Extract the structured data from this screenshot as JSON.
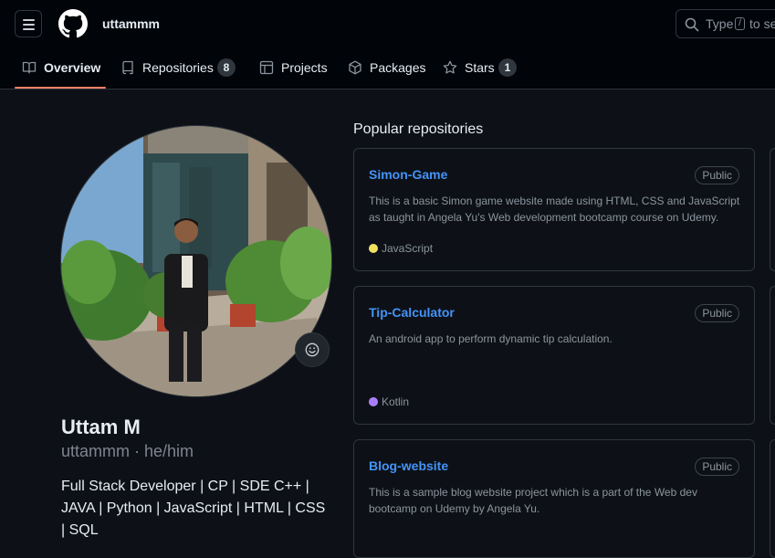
{
  "header": {
    "username": "uttammm",
    "search": {
      "prefix": "Type",
      "key": "/",
      "suffix": "to se"
    }
  },
  "tabs": [
    {
      "label": "Overview",
      "icon": "book-icon"
    },
    {
      "label": "Repositories",
      "icon": "repo-icon",
      "count": "8"
    },
    {
      "label": "Projects",
      "icon": "table-icon"
    },
    {
      "label": "Packages",
      "icon": "package-icon"
    },
    {
      "label": "Stars",
      "icon": "star-icon",
      "count": "1"
    }
  ],
  "profile": {
    "full_name": "Uttam M",
    "handle": "uttammm · he/him",
    "bio": "Full Stack Developer | CP | SDE C++ | JAVA | Python | JavaScript | HTML | CSS | SQL"
  },
  "popular": {
    "title": "Popular repositories",
    "repos": [
      {
        "name": "Simon-Game",
        "visibility": "Public",
        "description": "This is a basic Simon game website made using HTML, CSS and JavaScript as taught in Angela Yu's Web development bootcamp course on Udemy.",
        "language": "JavaScript",
        "language_color": "#f1e05a"
      },
      {
        "name": "Tip-Calculator",
        "visibility": "Public",
        "description": "An android app to perform dynamic tip calculation.",
        "language": "Kotlin",
        "language_color": "#a97bff"
      },
      {
        "name": "Blog-website",
        "visibility": "Public",
        "description": "This is a sample blog website project which is a part of the Web dev bootcamp on Udemy by Angela Yu.",
        "language": "",
        "language_color": ""
      }
    ]
  },
  "colors": {
    "accent": "#f78166",
    "link": "#4493f8",
    "bg": "#0d1117",
    "header_bg": "#010409"
  }
}
